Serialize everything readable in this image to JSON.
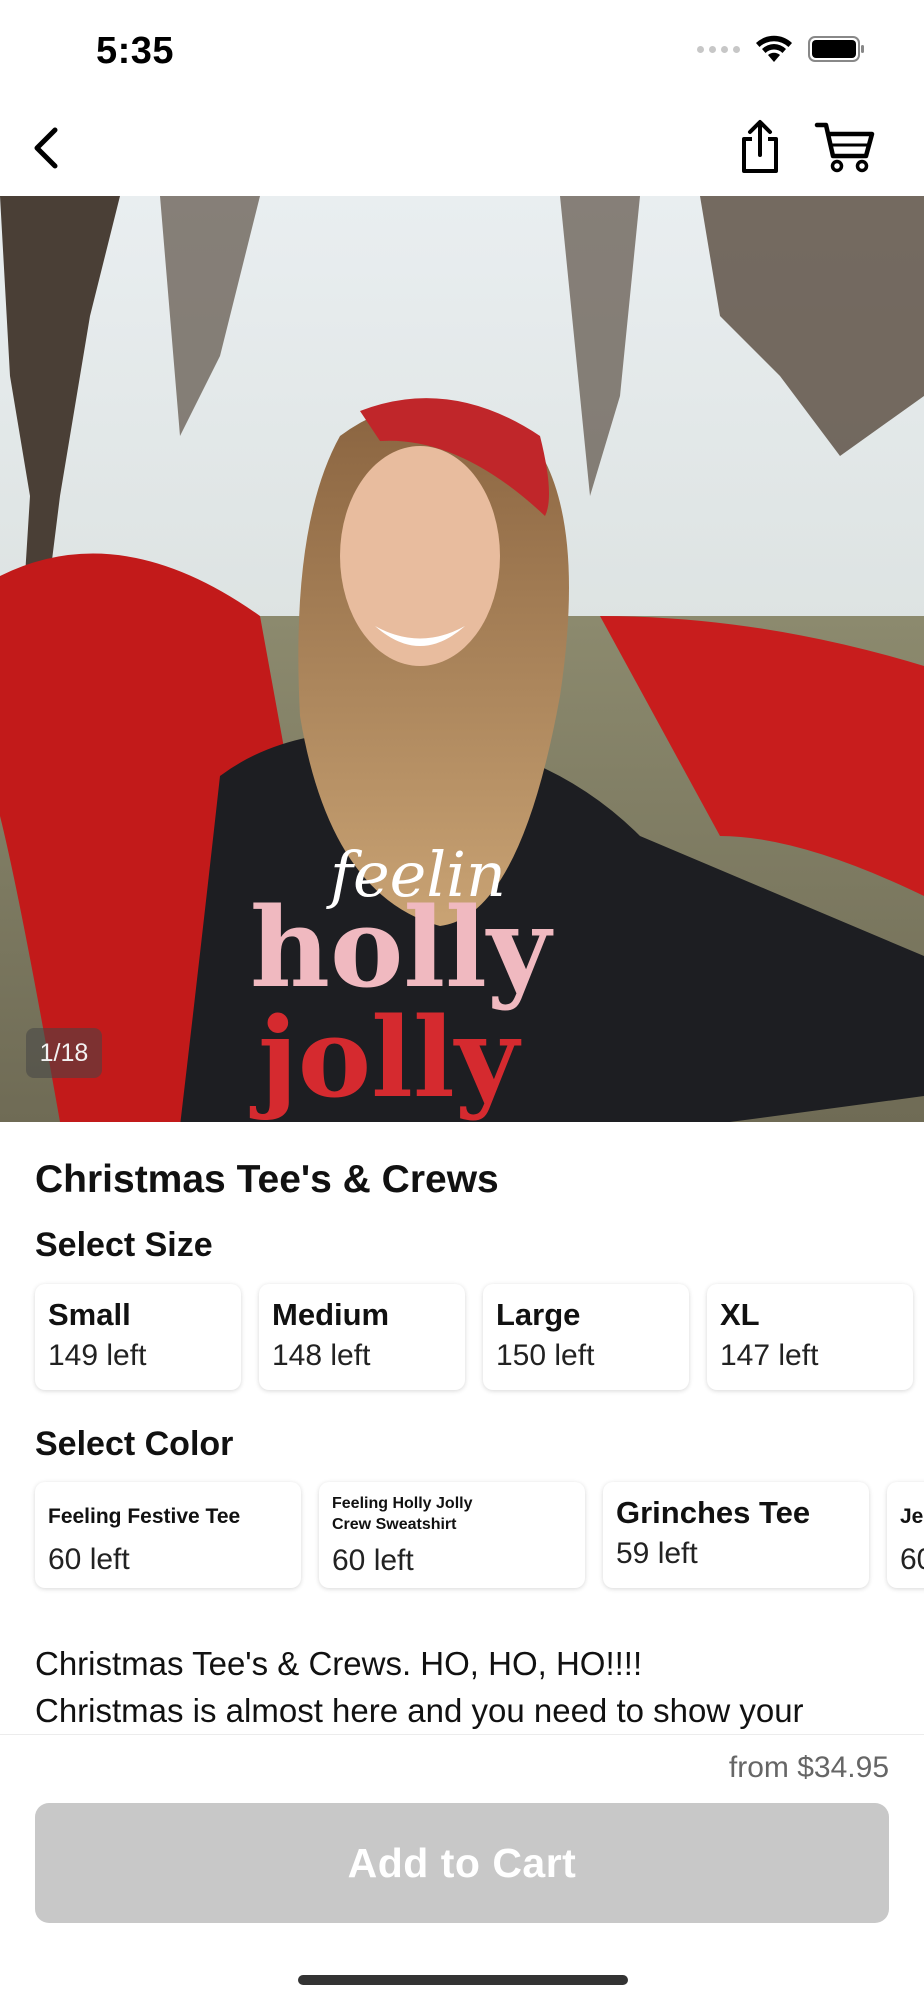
{
  "status_bar": {
    "time": "5:35"
  },
  "nav": {
    "back_icon": "chevron-left-icon",
    "share_icon": "share-icon",
    "cart_icon": "cart-icon"
  },
  "product": {
    "image_counter": "1/18",
    "title": "Christmas Tee's & Crews"
  },
  "size_section": {
    "label": "Select Size",
    "options": [
      {
        "name": "Small",
        "stock": "149 left"
      },
      {
        "name": "Medium",
        "stock": "148 left"
      },
      {
        "name": "Large",
        "stock": "150 left"
      },
      {
        "name": "XL",
        "stock": "147 left"
      }
    ]
  },
  "color_section": {
    "label": "Select Color",
    "options": [
      {
        "name": "Feeling Festive Tee",
        "stock": "60 left"
      },
      {
        "name": "Feeling Holly Jolly Crew Sweatshirt",
        "stock": "60 left"
      },
      {
        "name": "Grinches Tee",
        "stock": "59 left"
      },
      {
        "name": "Je",
        "stock": "60"
      }
    ]
  },
  "description": {
    "line1": "Christmas Tee's & Crews. HO, HO, HO!!!!",
    "line2": "Christmas is almost here and you need to show your"
  },
  "checkout": {
    "price": "from $34.95",
    "add_to_cart": "Add to Cart"
  },
  "colors": {
    "button_disabled": "#c8c8c8",
    "price_text": "#666666"
  }
}
